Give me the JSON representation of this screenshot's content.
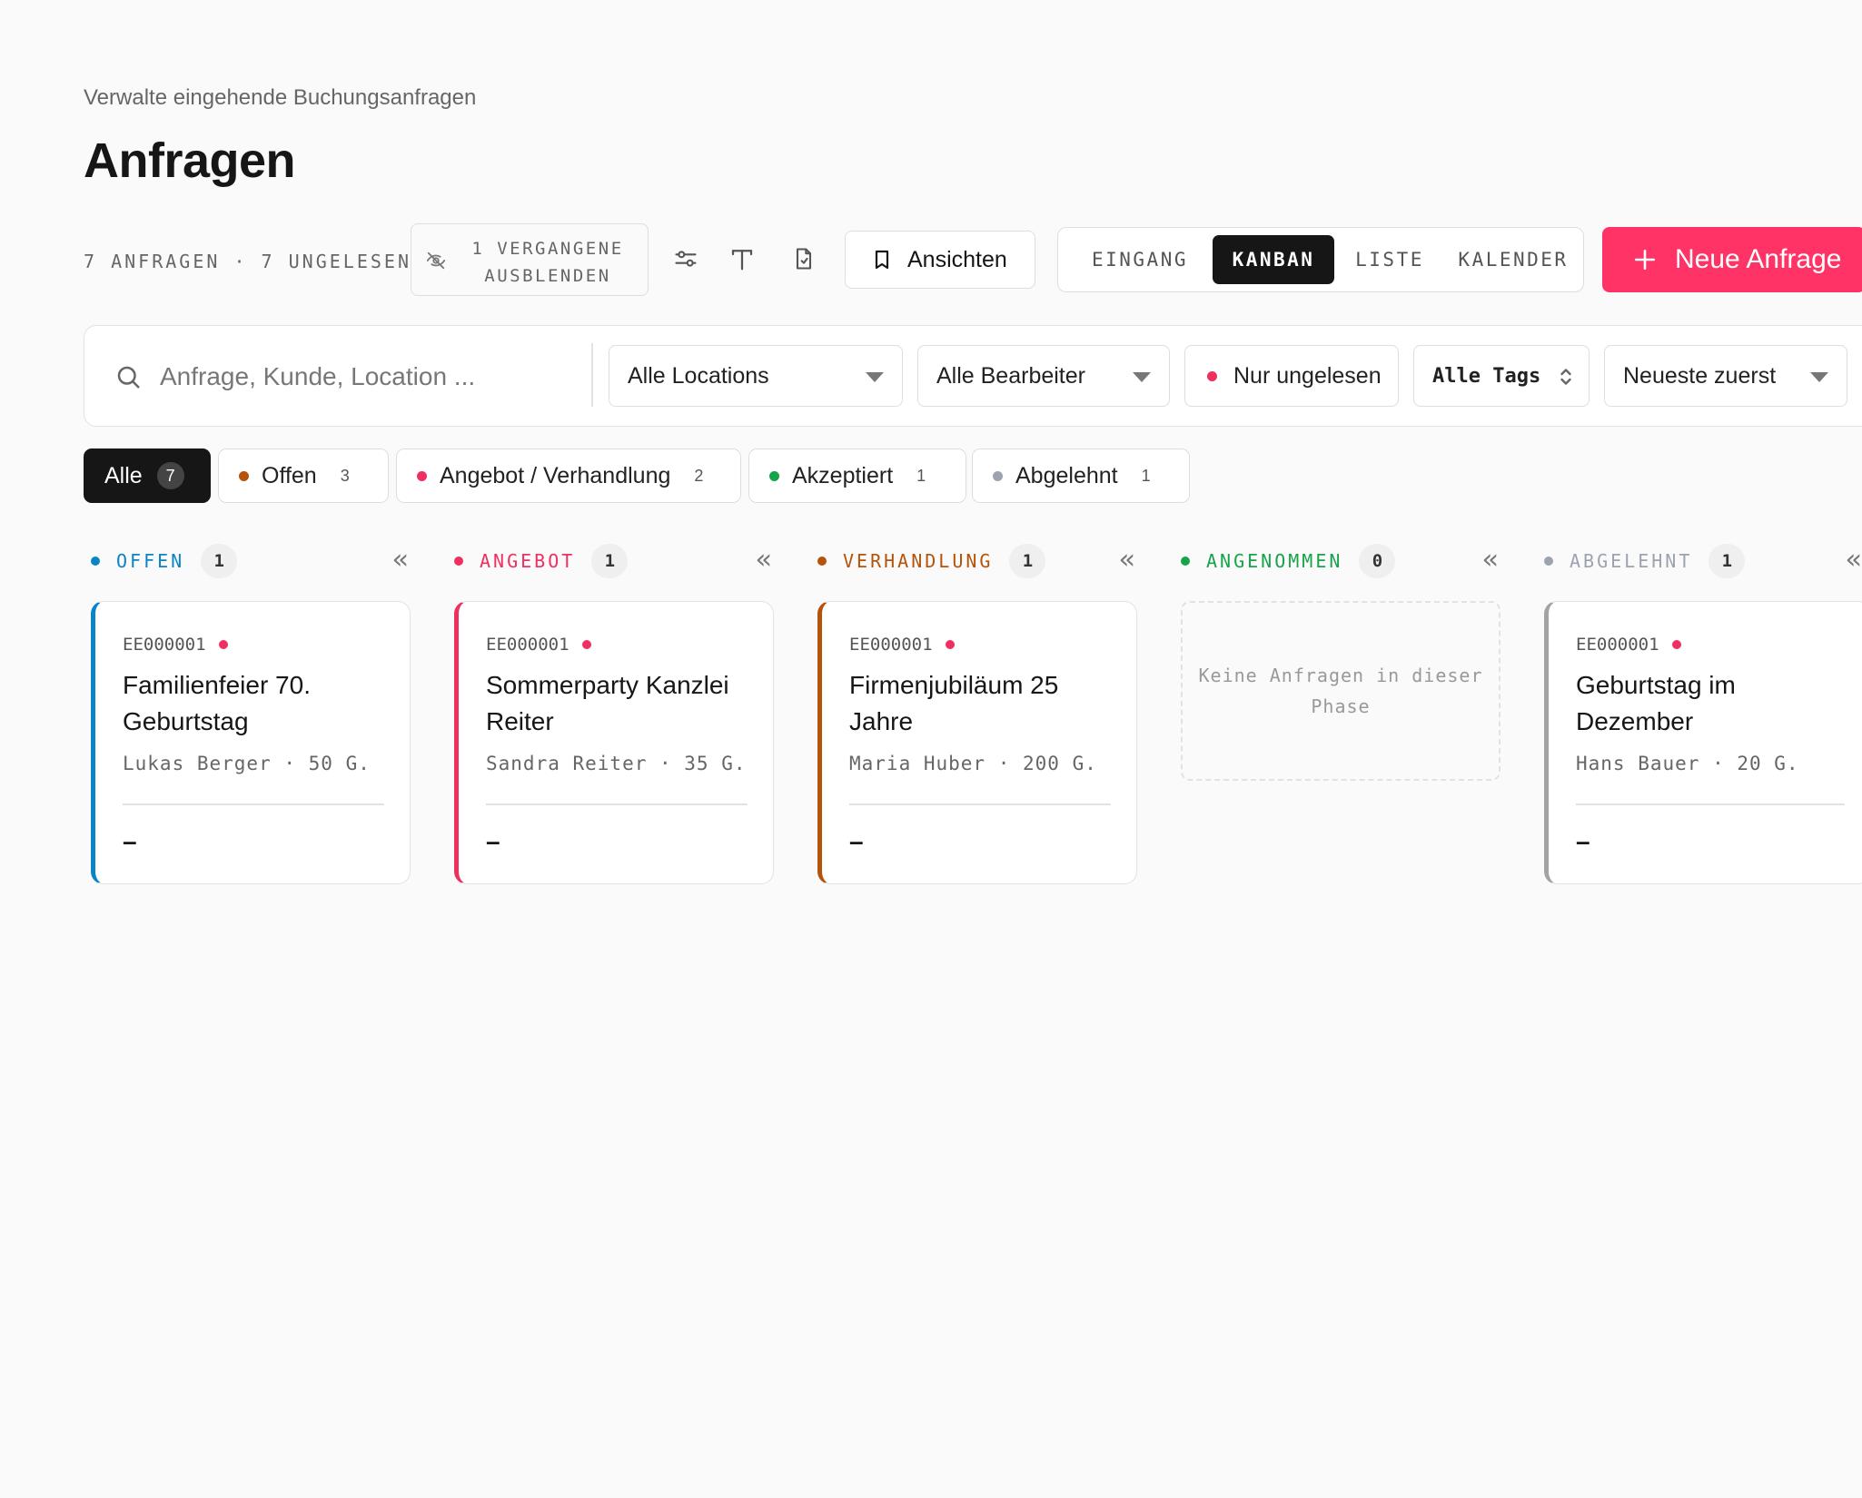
{
  "header": {
    "subtitle": "Verwalte eingehende Buchungsanfragen",
    "title": "Anfragen"
  },
  "toolbar": {
    "count_line": "7 ANFRAGEN · 7 UNGELESEN",
    "hide_past_label": "1 VERGANGENE AUSBLENDEN",
    "icons": [
      "eye-off-icon",
      "sliders-icon",
      "text-icon",
      "document-icon"
    ],
    "views_label": "Ansichten",
    "view_tabs": [
      {
        "label": "EINGANG",
        "active": false
      },
      {
        "label": "KANBAN",
        "active": true
      },
      {
        "label": "LISTE",
        "active": false
      },
      {
        "label": "KALENDER",
        "active": false
      }
    ],
    "new_label": "Neue Anfrage"
  },
  "filters": {
    "search_placeholder": "Anfrage, Kunde, Location ...",
    "location": "Alle Locations",
    "editor": "Alle Bearbeiter",
    "unread": "Nur ungelesen",
    "tags": "Alle Tags",
    "sort": "Neueste zuerst"
  },
  "status_chips": [
    {
      "label": "Alle",
      "count": "7",
      "active": true,
      "color": null
    },
    {
      "label": "Offen",
      "count": "3",
      "active": false,
      "color": "#b45309"
    },
    {
      "label": "Angebot / Verhandlung",
      "count": "2",
      "active": false,
      "color": "#ee2f5f"
    },
    {
      "label": "Akzeptiert",
      "count": "1",
      "active": false,
      "color": "#16a34a"
    },
    {
      "label": "Abgelehnt",
      "count": "1",
      "active": false,
      "color": "#9ca3af"
    }
  ],
  "columns": [
    {
      "name": "OFFEN",
      "count": "1",
      "color": "#0a84c6",
      "card": {
        "ref": "EE000001",
        "title": "Familienfeier 70. Geburtstag",
        "meta": "Lukas Berger · 50 G.",
        "amount": "–"
      }
    },
    {
      "name": "ANGEBOT",
      "count": "1",
      "color": "#ee2f5f",
      "card": {
        "ref": "EE000001",
        "title": "Sommerparty Kanzlei Reiter",
        "meta": "Sandra Reiter · 35 G.",
        "amount": "–"
      }
    },
    {
      "name": "VERHANDLUNG",
      "count": "1",
      "color": "#b45309",
      "card": {
        "ref": "EE000001",
        "title": "Firmenjubiläum 25 Jahre",
        "meta": "Maria Huber · 200 G.",
        "amount": "–"
      }
    },
    {
      "name": "ANGENOMMEN",
      "count": "0",
      "color": "#16a34a",
      "empty_text": "Keine Anfragen in dieser Phase"
    },
    {
      "name": "ABGELEHNT",
      "count": "1",
      "color": "#9ca3af",
      "card": {
        "ref": "EE000001",
        "title": "Geburtstag im Dezember",
        "meta": "Hans Bauer · 20 G.",
        "amount": "–"
      }
    }
  ],
  "colors": {
    "accent": "#ff3366",
    "dark": "#161616",
    "unread_dot": "#ee2f5f"
  }
}
